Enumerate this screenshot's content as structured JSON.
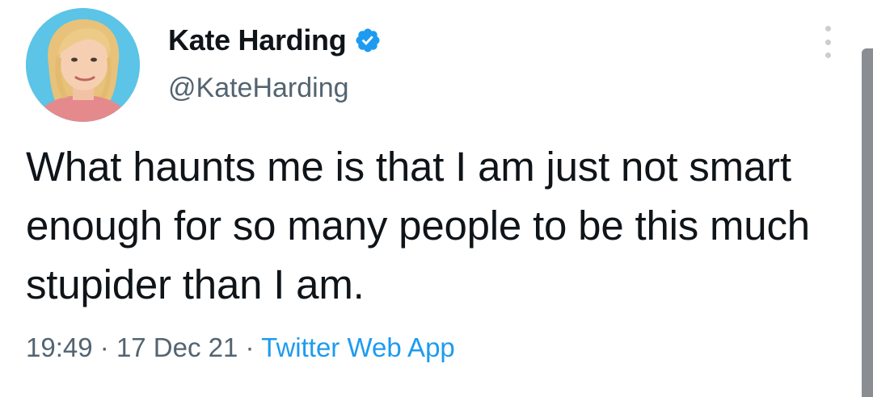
{
  "tweet": {
    "author": {
      "display_name": "Kate Harding",
      "handle": "@KateHarding",
      "verified": true
    },
    "text": "What haunts me is that I am just not smart enough for so many people to be this much stupider than I am.",
    "time": "19:49",
    "separator": "·",
    "date": "17 Dec 21",
    "source": "Twitter Web App"
  },
  "icons": {
    "verified": "verified-badge-icon",
    "more": "more-options-icon"
  },
  "colors": {
    "accent": "#1d9bf0",
    "text": "#0f1419",
    "muted": "#536471",
    "avatar_bg": "#5cc4e6"
  }
}
